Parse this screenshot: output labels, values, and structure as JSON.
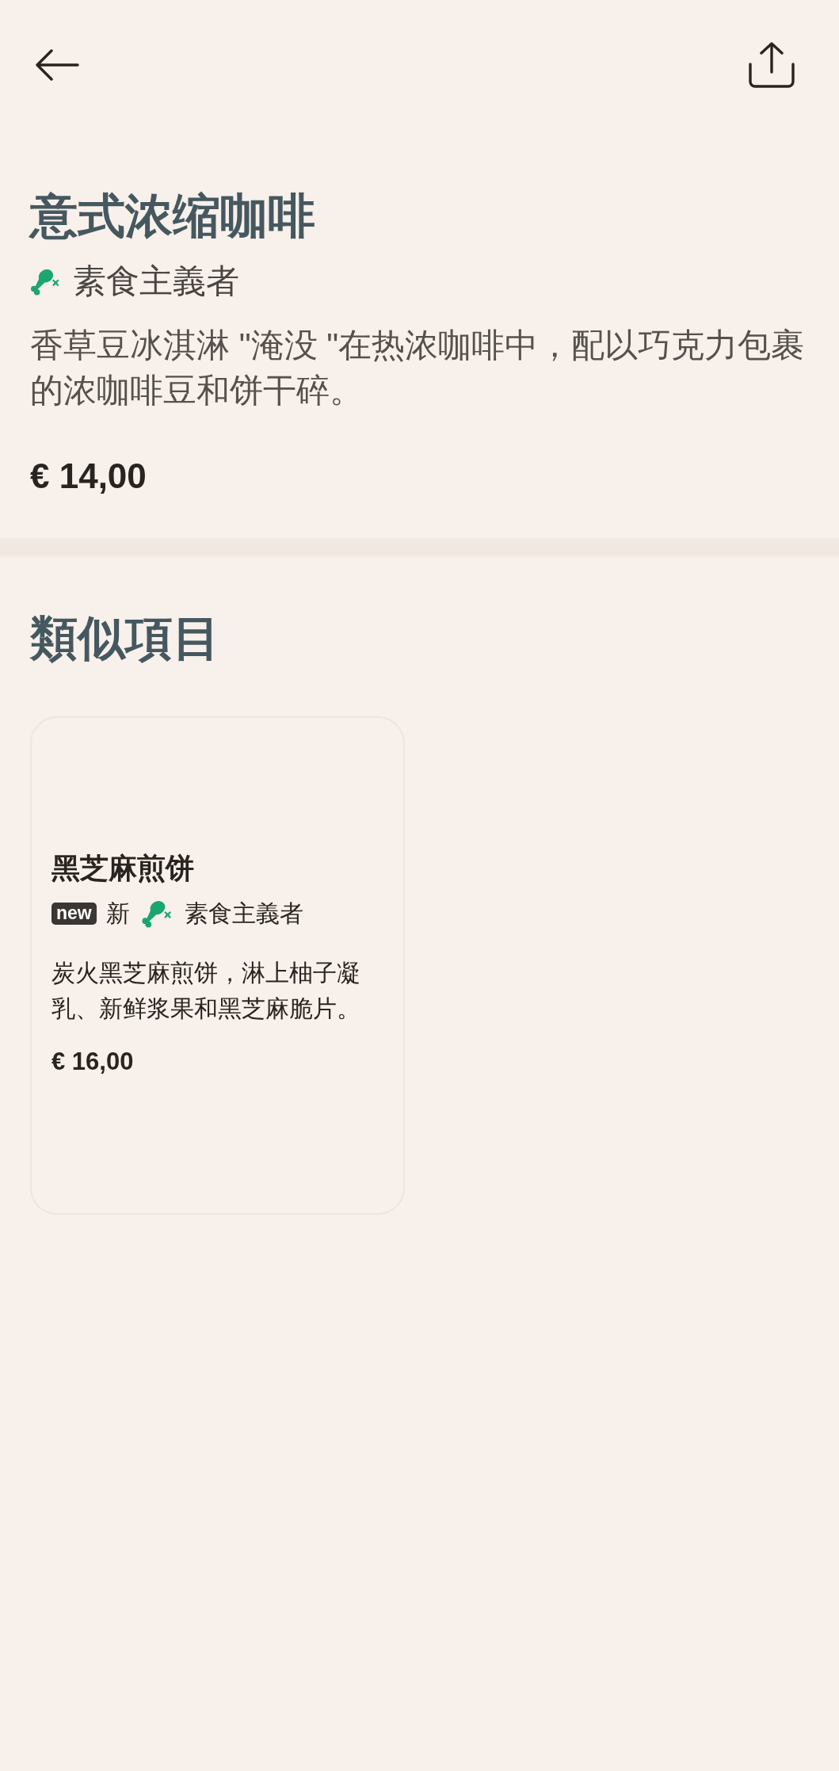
{
  "item": {
    "title": "意式浓缩咖啡",
    "tags": [
      {
        "kind": "diet",
        "label": "素食主義者"
      }
    ],
    "description": "香草豆冰淇淋 \"淹没 \"在热浓咖啡中，配以巧克力包裹的浓咖啡豆和饼干碎。",
    "price": "€ 14,00"
  },
  "similar_items": {
    "title": "類似項目",
    "cards": [
      {
        "title": "黑芝麻煎饼",
        "tags": [
          {
            "kind": "new",
            "badge": "new",
            "label": "新"
          },
          {
            "kind": "diet",
            "label": "素食主義者"
          }
        ],
        "description": "炭火黑芝麻煎饼，淋上柚子凝乳、新鲜浆果和黑芝麻脆片。",
        "price": "€ 16,00"
      }
    ]
  }
}
